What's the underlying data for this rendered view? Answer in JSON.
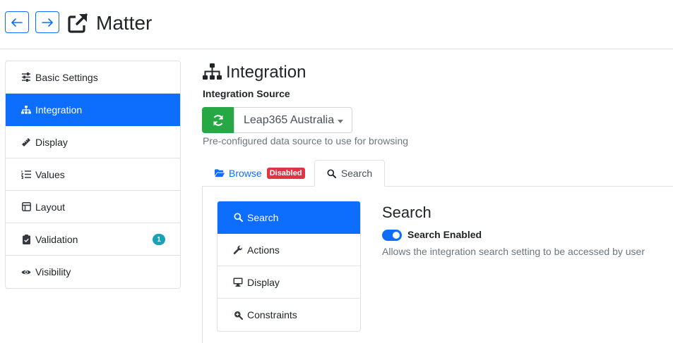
{
  "header": {
    "title": "Matter",
    "back_icon": "arrow-left-icon",
    "forward_icon": "arrow-right-icon",
    "title_icon": "external-link-icon"
  },
  "sidebar": {
    "items": [
      {
        "label": "Basic Settings",
        "icon": "sliders-icon",
        "active": false
      },
      {
        "label": "Integration",
        "icon": "sitemap-icon",
        "active": true
      },
      {
        "label": "Display",
        "icon": "ruler-icon",
        "active": false
      },
      {
        "label": "Values",
        "icon": "list-ol-icon",
        "active": false
      },
      {
        "label": "Layout",
        "icon": "layout-icon",
        "active": false
      },
      {
        "label": "Validation",
        "icon": "clipboard-check-icon",
        "active": false,
        "badge": "1"
      },
      {
        "label": "Visibility",
        "icon": "eye-icon",
        "active": false
      }
    ]
  },
  "main": {
    "section_title": "Integration",
    "source_label": "Integration Source",
    "source_value": "Leap365 Australia",
    "source_help": "Pre-configured data source to use for browsing",
    "tabs": [
      {
        "label": "Browse",
        "badge": "Disabled",
        "icon": "folder-open-icon"
      },
      {
        "label": "Search",
        "icon": "search-icon",
        "active": true
      }
    ],
    "inner_items": [
      {
        "label": "Search",
        "icon": "search-icon",
        "active": true
      },
      {
        "label": "Actions",
        "icon": "wrench-icon",
        "active": false
      },
      {
        "label": "Display",
        "icon": "desktop-icon",
        "active": false
      },
      {
        "label": "Constraints",
        "icon": "search-plus-icon",
        "active": false
      }
    ],
    "search": {
      "heading": "Search",
      "toggle_label": "Search Enabled",
      "toggle_on": true,
      "help": "Allows the integration search setting to be accessed by user"
    }
  },
  "colors": {
    "primary": "#0d6efd",
    "success": "#28a745",
    "danger": "#dc3545",
    "info": "#17a2b8"
  }
}
